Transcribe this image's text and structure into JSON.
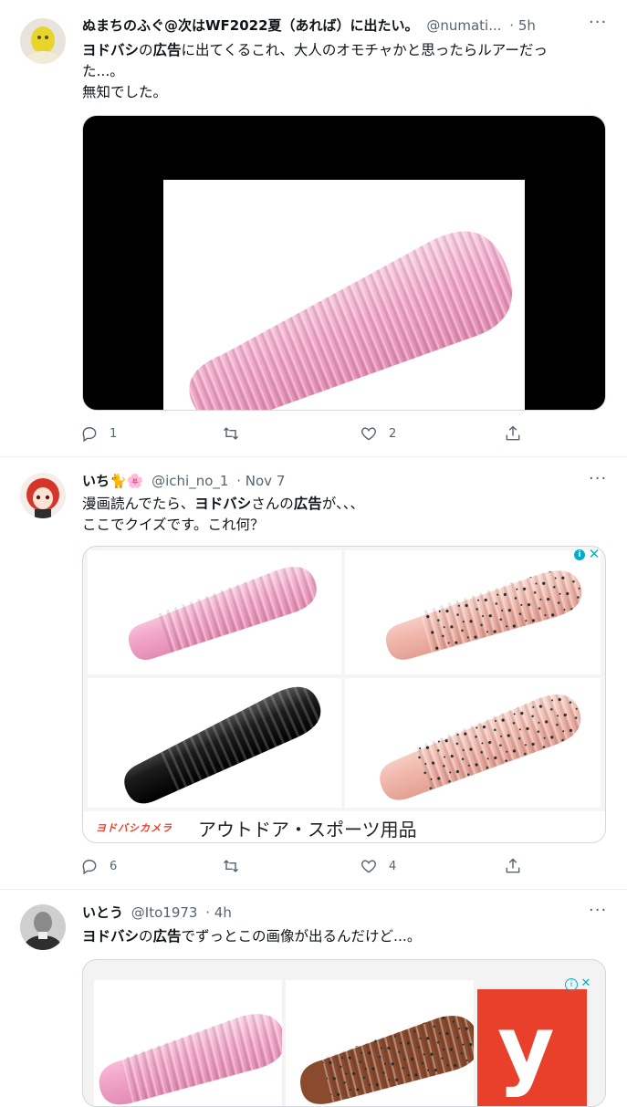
{
  "tweets": [
    {
      "name": "ぬまちのふぐ@次はWF2022夏（あれば）に出たい。",
      "handle": "@numati...",
      "time": "· 5h",
      "text_line1_bold": "ヨドバシ",
      "text_line1_rest": "の",
      "text_line1_bold2": "広告",
      "text_line1_tail": "に出てくるこれ、大人のオモチャかと思ったらルアーだっ",
      "text_line2": "た...。",
      "text_line3": "無知でした。",
      "reply_count": "1",
      "retweet_count": "",
      "like_count": "2"
    },
    {
      "name": "いち🐈🌸",
      "handle": "@ichi_no_1",
      "time": "· Nov 7",
      "text_line1_pre": "漫画読んでたら、",
      "text_line1_bold": "ヨドバシ",
      "text_line1_mid": "さんの",
      "text_line1_bold2": "広告",
      "text_line1_tail": "が、、、",
      "text_line2": "ここでクイズです。これ何？",
      "ad_brand": "ヨドバシカメラ",
      "ad_caption": "アウトドア・スポーツ用品",
      "reply_count": "6",
      "retweet_count": "",
      "like_count": "4"
    },
    {
      "name": "いとう",
      "handle": "@Ito1973",
      "time": "· 4h",
      "text_bold": "ヨドバシ",
      "text_rest": "の",
      "text_bold2": "広告",
      "text_tail": "でずっとこの画像が出るんだけど...。",
      "ad_logo_letter": "y"
    }
  ],
  "colors": {
    "secondary_text": "#536471",
    "border": "#cfd9de",
    "lure_pink": "#f2a7c8",
    "lure_black": "#1a1a1a",
    "lure_salmon": "#f0b8ad",
    "yodobashi_red": "#e8402a"
  },
  "icons": [
    "reply-icon",
    "retweet-icon",
    "like-icon",
    "share-icon",
    "more-icon"
  ]
}
